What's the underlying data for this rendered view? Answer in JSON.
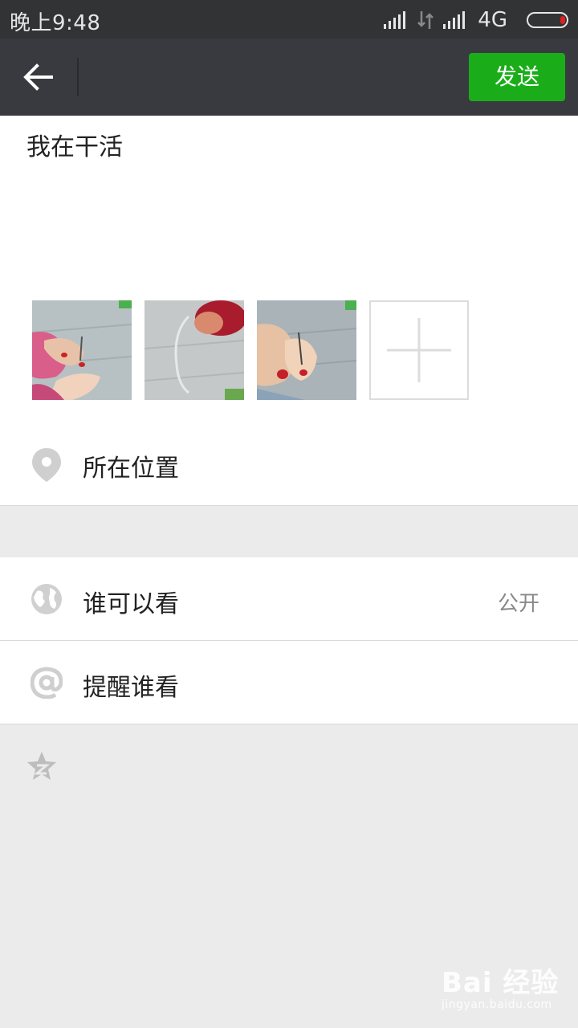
{
  "status_bar": {
    "time": "晚上9:48",
    "network": "4G",
    "battery_color": "#e02020"
  },
  "nav": {
    "back_icon": "arrow-left-icon",
    "send_label": "发送",
    "accent": "#1aad19"
  },
  "compose": {
    "text": "我在干活",
    "photos": [
      "photo-1",
      "photo-2",
      "photo-3"
    ],
    "add_icon": "plus-icon"
  },
  "location": {
    "icon": "location-pin-icon",
    "label": "所在位置"
  },
  "visibility": {
    "icon": "globe-icon",
    "label": "谁可以看",
    "value": "公开"
  },
  "mention": {
    "icon": "at-sign-icon",
    "label": "提醒谁看"
  },
  "qzone": {
    "icon": "qzone-star-icon"
  },
  "watermark": {
    "main": "Bai  经验",
    "sub": "jingyan.baidu.com"
  }
}
